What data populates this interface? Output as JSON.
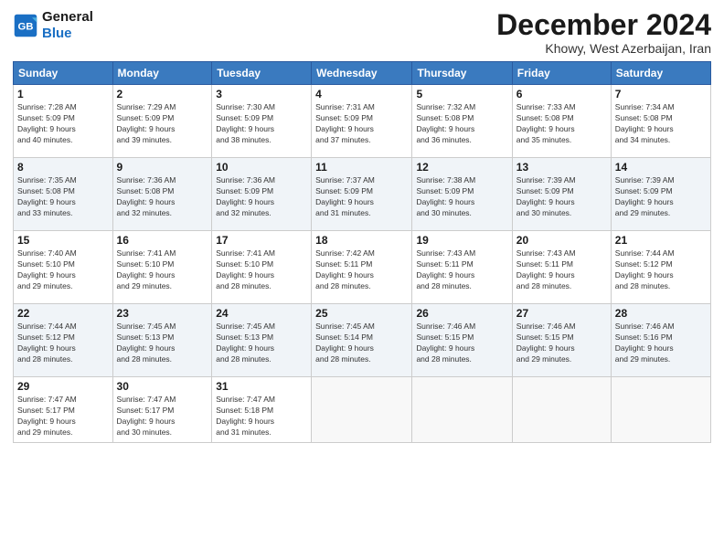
{
  "header": {
    "logo_line1": "General",
    "logo_line2": "Blue",
    "month": "December 2024",
    "location": "Khowy, West Azerbaijan, Iran"
  },
  "weekdays": [
    "Sunday",
    "Monday",
    "Tuesday",
    "Wednesday",
    "Thursday",
    "Friday",
    "Saturday"
  ],
  "weeks": [
    [
      {
        "day": "1",
        "info": "Sunrise: 7:28 AM\nSunset: 5:09 PM\nDaylight: 9 hours\nand 40 minutes."
      },
      {
        "day": "2",
        "info": "Sunrise: 7:29 AM\nSunset: 5:09 PM\nDaylight: 9 hours\nand 39 minutes."
      },
      {
        "day": "3",
        "info": "Sunrise: 7:30 AM\nSunset: 5:09 PM\nDaylight: 9 hours\nand 38 minutes."
      },
      {
        "day": "4",
        "info": "Sunrise: 7:31 AM\nSunset: 5:09 PM\nDaylight: 9 hours\nand 37 minutes."
      },
      {
        "day": "5",
        "info": "Sunrise: 7:32 AM\nSunset: 5:08 PM\nDaylight: 9 hours\nand 36 minutes."
      },
      {
        "day": "6",
        "info": "Sunrise: 7:33 AM\nSunset: 5:08 PM\nDaylight: 9 hours\nand 35 minutes."
      },
      {
        "day": "7",
        "info": "Sunrise: 7:34 AM\nSunset: 5:08 PM\nDaylight: 9 hours\nand 34 minutes."
      }
    ],
    [
      {
        "day": "8",
        "info": "Sunrise: 7:35 AM\nSunset: 5:08 PM\nDaylight: 9 hours\nand 33 minutes."
      },
      {
        "day": "9",
        "info": "Sunrise: 7:36 AM\nSunset: 5:08 PM\nDaylight: 9 hours\nand 32 minutes."
      },
      {
        "day": "10",
        "info": "Sunrise: 7:36 AM\nSunset: 5:09 PM\nDaylight: 9 hours\nand 32 minutes."
      },
      {
        "day": "11",
        "info": "Sunrise: 7:37 AM\nSunset: 5:09 PM\nDaylight: 9 hours\nand 31 minutes."
      },
      {
        "day": "12",
        "info": "Sunrise: 7:38 AM\nSunset: 5:09 PM\nDaylight: 9 hours\nand 30 minutes."
      },
      {
        "day": "13",
        "info": "Sunrise: 7:39 AM\nSunset: 5:09 PM\nDaylight: 9 hours\nand 30 minutes."
      },
      {
        "day": "14",
        "info": "Sunrise: 7:39 AM\nSunset: 5:09 PM\nDaylight: 9 hours\nand 29 minutes."
      }
    ],
    [
      {
        "day": "15",
        "info": "Sunrise: 7:40 AM\nSunset: 5:10 PM\nDaylight: 9 hours\nand 29 minutes."
      },
      {
        "day": "16",
        "info": "Sunrise: 7:41 AM\nSunset: 5:10 PM\nDaylight: 9 hours\nand 29 minutes."
      },
      {
        "day": "17",
        "info": "Sunrise: 7:41 AM\nSunset: 5:10 PM\nDaylight: 9 hours\nand 28 minutes."
      },
      {
        "day": "18",
        "info": "Sunrise: 7:42 AM\nSunset: 5:11 PM\nDaylight: 9 hours\nand 28 minutes."
      },
      {
        "day": "19",
        "info": "Sunrise: 7:43 AM\nSunset: 5:11 PM\nDaylight: 9 hours\nand 28 minutes."
      },
      {
        "day": "20",
        "info": "Sunrise: 7:43 AM\nSunset: 5:11 PM\nDaylight: 9 hours\nand 28 minutes."
      },
      {
        "day": "21",
        "info": "Sunrise: 7:44 AM\nSunset: 5:12 PM\nDaylight: 9 hours\nand 28 minutes."
      }
    ],
    [
      {
        "day": "22",
        "info": "Sunrise: 7:44 AM\nSunset: 5:12 PM\nDaylight: 9 hours\nand 28 minutes."
      },
      {
        "day": "23",
        "info": "Sunrise: 7:45 AM\nSunset: 5:13 PM\nDaylight: 9 hours\nand 28 minutes."
      },
      {
        "day": "24",
        "info": "Sunrise: 7:45 AM\nSunset: 5:13 PM\nDaylight: 9 hours\nand 28 minutes."
      },
      {
        "day": "25",
        "info": "Sunrise: 7:45 AM\nSunset: 5:14 PM\nDaylight: 9 hours\nand 28 minutes."
      },
      {
        "day": "26",
        "info": "Sunrise: 7:46 AM\nSunset: 5:15 PM\nDaylight: 9 hours\nand 28 minutes."
      },
      {
        "day": "27",
        "info": "Sunrise: 7:46 AM\nSunset: 5:15 PM\nDaylight: 9 hours\nand 29 minutes."
      },
      {
        "day": "28",
        "info": "Sunrise: 7:46 AM\nSunset: 5:16 PM\nDaylight: 9 hours\nand 29 minutes."
      }
    ],
    [
      {
        "day": "29",
        "info": "Sunrise: 7:47 AM\nSunset: 5:17 PM\nDaylight: 9 hours\nand 29 minutes."
      },
      {
        "day": "30",
        "info": "Sunrise: 7:47 AM\nSunset: 5:17 PM\nDaylight: 9 hours\nand 30 minutes."
      },
      {
        "day": "31",
        "info": "Sunrise: 7:47 AM\nSunset: 5:18 PM\nDaylight: 9 hours\nand 31 minutes."
      },
      {
        "day": "",
        "info": ""
      },
      {
        "day": "",
        "info": ""
      },
      {
        "day": "",
        "info": ""
      },
      {
        "day": "",
        "info": ""
      }
    ]
  ]
}
